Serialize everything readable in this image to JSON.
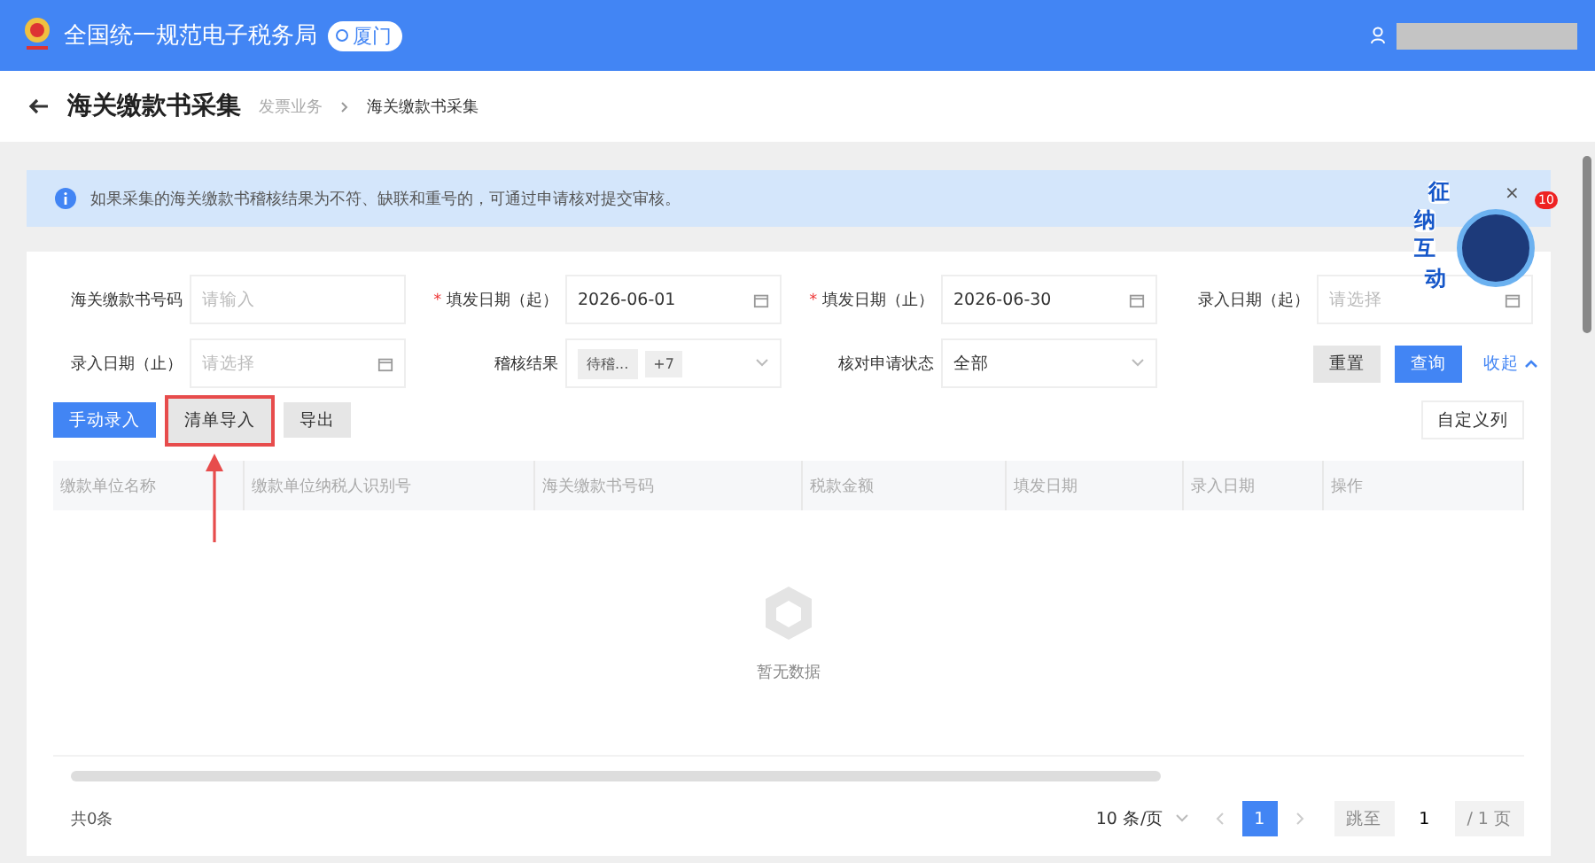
{
  "header": {
    "title": "全国统一规范电子税务局",
    "location": "厦门"
  },
  "page": {
    "title": "海关缴款书采集",
    "breadcrumb": [
      "发票业务",
      "海关缴款书采集"
    ]
  },
  "notice": "如果采集的海关缴款书稽核结果为不符、缺联和重号的，可通过申请核对提交审核。",
  "required_mark": "*",
  "filters": [
    {
      "label": "海关缴款书号码",
      "required": false,
      "kind": "text",
      "placeholder": "请输入"
    },
    {
      "label": "填发日期（起）",
      "required": true,
      "kind": "date",
      "value": "2026-06-01"
    },
    {
      "label": "填发日期（止）",
      "required": true,
      "kind": "date",
      "value": "2026-06-30"
    },
    {
      "label": "录入日期（起）",
      "required": false,
      "kind": "date",
      "placeholder": "请选择"
    },
    {
      "label": "录入日期（止）",
      "required": false,
      "kind": "date",
      "placeholder": "请选择"
    },
    {
      "label": "稽核结果",
      "required": false,
      "kind": "tags",
      "tags": [
        "待稽...",
        "+7"
      ]
    },
    {
      "label": "核对申请状态",
      "required": false,
      "kind": "select",
      "value": "全部"
    }
  ],
  "filter_buttons": {
    "reset": "重置",
    "query": "查询",
    "collapse": "收起"
  },
  "actions": [
    {
      "label": "手动录入",
      "primary": true,
      "highlighted": false
    },
    {
      "label": "清单导入",
      "primary": false,
      "highlighted": true
    },
    {
      "label": "导出",
      "primary": false,
      "highlighted": false
    }
  ],
  "customize": "自定义列",
  "table": {
    "columns": [
      {
        "label": "缴款单位名称"
      },
      {
        "label": "缴款单位纳税人识别号"
      },
      {
        "label": "海关缴款书号码"
      },
      {
        "label": "税款金额"
      },
      {
        "label": "填发日期"
      },
      {
        "label": "录入日期"
      },
      {
        "label": "操作"
      }
    ],
    "empty": "暂无数据"
  },
  "pagination": {
    "total": "共0条",
    "page_size": "10 条/页",
    "pages": [
      {
        "label": "1",
        "selected": true
      }
    ],
    "jump_label": "跳至",
    "jump_value": "1",
    "page_count": "/ 1 页"
  },
  "assistant": {
    "chars": [
      "征",
      "纳",
      "互",
      "动"
    ],
    "badge": "10",
    "close": "×"
  }
}
